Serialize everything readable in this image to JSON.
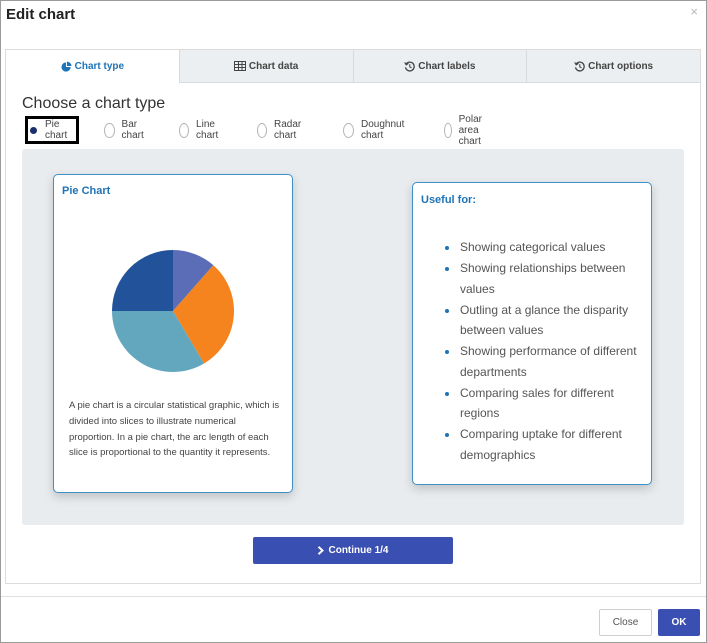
{
  "dialog": {
    "title": "Edit chart",
    "close_glyph": "×"
  },
  "tabs": [
    {
      "label": "Chart type",
      "icon": "pie-icon",
      "active": true
    },
    {
      "label": "Chart data",
      "icon": "table-icon",
      "active": false
    },
    {
      "label": "Chart labels",
      "icon": "history-icon",
      "active": false
    },
    {
      "label": "Chart options",
      "icon": "history-icon",
      "active": false
    }
  ],
  "chooser": {
    "heading": "Choose a chart type",
    "options": [
      {
        "label": "Pie chart",
        "selected": true
      },
      {
        "label": "Bar chart",
        "selected": false
      },
      {
        "label": "Line chart",
        "selected": false
      },
      {
        "label": "Radar chart",
        "selected": false
      },
      {
        "label": "Doughnut chart",
        "selected": false
      },
      {
        "label": "Polar area chart",
        "selected": false
      }
    ]
  },
  "preview": {
    "title": "Pie Chart",
    "description": "A pie chart is a circular statistical graphic, which is divided into slices to illustrate numerical proportion. In a pie chart, the arc length of each slice is proportional to the quantity it represents.",
    "pie_slices": [
      {
        "fraction": 0.115,
        "color": "#5b6db7"
      },
      {
        "fraction": 0.3,
        "color": "#f5841f"
      },
      {
        "fraction": 0.335,
        "color": "#63a7bf"
      },
      {
        "fraction": 0.25,
        "color": "#22539a"
      }
    ]
  },
  "useful_for": {
    "title": "Useful for:",
    "items": [
      "Showing categorical values",
      "Showing relationships between values",
      "Outling at a glance the disparity between values",
      "Showing performance of different departments",
      "Comparing sales for different regions",
      "Comparing uptake for different demographics"
    ]
  },
  "continue_label": "Continue 1/4",
  "footer": {
    "close_label": "Close",
    "ok_label": "OK"
  },
  "colors": {
    "accent": "#1f73b7",
    "primary_button": "#3a4fb2",
    "stage_bg": "#e9ecef"
  }
}
